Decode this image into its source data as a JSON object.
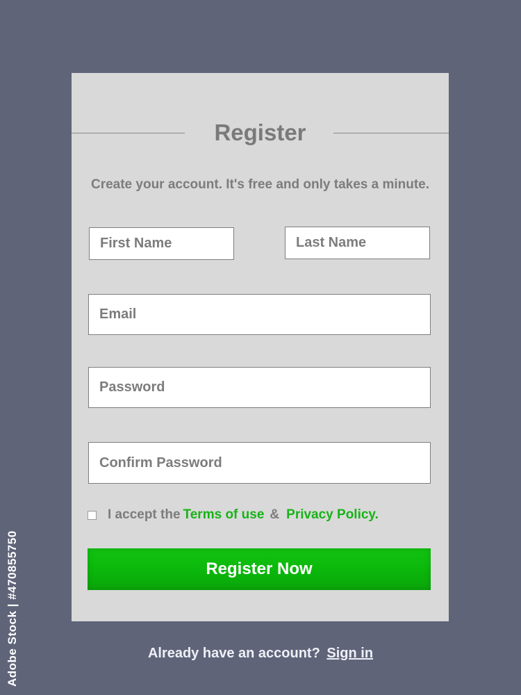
{
  "form": {
    "title": "Register",
    "subtitle": "Create your account. It's free and only takes a minute.",
    "fields": {
      "first_name_placeholder": "First Name",
      "last_name_placeholder": "Last Name",
      "email_placeholder": "Email",
      "password_placeholder": "Password",
      "confirm_password_placeholder": "Confirm Password"
    },
    "terms": {
      "checked": false,
      "prefix": "I accept the",
      "terms_link": "Terms of use",
      "ampersand": "&",
      "privacy_link": "Privacy Policy."
    },
    "submit_label": "Register Now"
  },
  "footer": {
    "question": "Already have an account?",
    "signin_link": "Sign in"
  },
  "watermark": {
    "side_id": "Adobe Stock | #470855750"
  },
  "colors": {
    "background": "#5f6479",
    "card": "#d9d9d9",
    "accent_green": "#0bb80b",
    "link_green": "#17b317",
    "text_gray": "#7c7c7c"
  }
}
